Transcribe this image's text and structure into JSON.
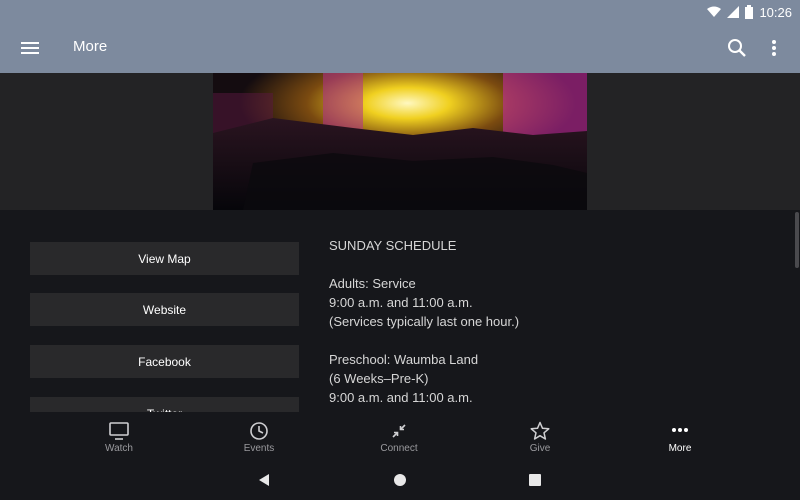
{
  "status": {
    "time": "10:26"
  },
  "toolbar": {
    "title": "More",
    "menu_icon": "hamburger-menu-icon",
    "search_icon": "search-icon",
    "overflow_icon": "overflow-menu-icon"
  },
  "hero": {
    "image": "concert-stage-photo"
  },
  "buttons": {
    "view_map": "View Map",
    "website": "Website",
    "facebook": "Facebook",
    "twitter": "Twitter"
  },
  "schedule": {
    "heading": "SUNDAY SCHEDULE",
    "adults_title": "Adults: Service",
    "adults_times": "9:00 a.m. and 11:00 a.m.",
    "adults_note": "(Services typically last one hour.)",
    "preschool_title": "Preschool: Waumba Land",
    "preschool_ages": "(6 Weeks–Pre-K)",
    "preschool_times": "9:00 a.m. and 11:00 a.m."
  },
  "nav": [
    {
      "label": "Watch",
      "icon": "tv-icon",
      "active": false
    },
    {
      "label": "Events",
      "icon": "clock-icon",
      "active": false
    },
    {
      "label": "Connect",
      "icon": "connect-arrows-icon",
      "active": false
    },
    {
      "label": "Give",
      "icon": "star-icon",
      "active": false
    },
    {
      "label": "More",
      "icon": "more-dots-icon",
      "active": true
    }
  ],
  "colors": {
    "appbar": "#7d8a9e",
    "background": "#16171b",
    "button": "#29292b"
  }
}
